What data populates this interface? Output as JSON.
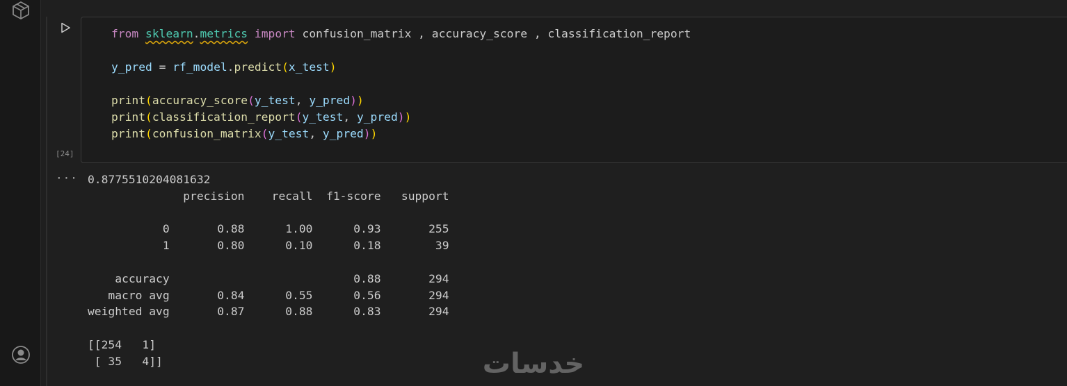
{
  "activity_bar": {
    "top_icon": "package-icon",
    "bottom_icon": "account-icon"
  },
  "cell": {
    "run_icon": "play-icon",
    "execution_count": "[24]",
    "code": {
      "line1": {
        "from": "from",
        "module_a": "sklearn",
        "dot": ".",
        "module_b": "metrics",
        "import": "import",
        "names": "confusion_matrix , accuracy_score , classification_report"
      },
      "line2": {
        "var": "y_pred",
        "eq": " = ",
        "obj": "rf_model",
        "dot": ".",
        "fn": "predict",
        "open": "(",
        "arg": "x_test",
        "close": ")"
      },
      "line3": {
        "print": "print",
        "o1": "(",
        "fn": "accuracy_score",
        "o2": "(",
        "a1": "y_test",
        "comma": ", ",
        "a2": "y_pred",
        "c2": ")",
        "c1": ")"
      },
      "line4": {
        "print": "print",
        "o1": "(",
        "fn": "classification_report",
        "o2": "(",
        "a1": "y_test",
        "comma": ", ",
        "a2": "y_pred",
        "c2": ")",
        "c1": ")"
      },
      "line5": {
        "print": "print",
        "o1": "(",
        "fn": "confusion_matrix",
        "o2": "(",
        "a1": "y_test",
        "comma": ", ",
        "a2": "y_pred",
        "c2": ")",
        "c1": ")"
      }
    }
  },
  "output": {
    "marker": "···",
    "text": "0.8775510204081632\n              precision    recall  f1-score   support\n\n           0       0.88      1.00      0.93       255\n           1       0.80      0.10      0.18        39\n\n    accuracy                           0.88       294\n   macro avg       0.84      0.55      0.56       294\nweighted avg       0.87      0.88      0.83       294\n\n[[254   1]\n [ 35   4]]"
  },
  "watermark": {
    "text": "خدسات"
  },
  "colors": {
    "background": "#1f1f1f",
    "keyword": "#c586c0",
    "module": "#4ec9b0",
    "function": "#dcdcaa",
    "variable": "#9cdcfe",
    "bracket_outer": "#ffd700",
    "bracket_inner": "#da70d6"
  }
}
